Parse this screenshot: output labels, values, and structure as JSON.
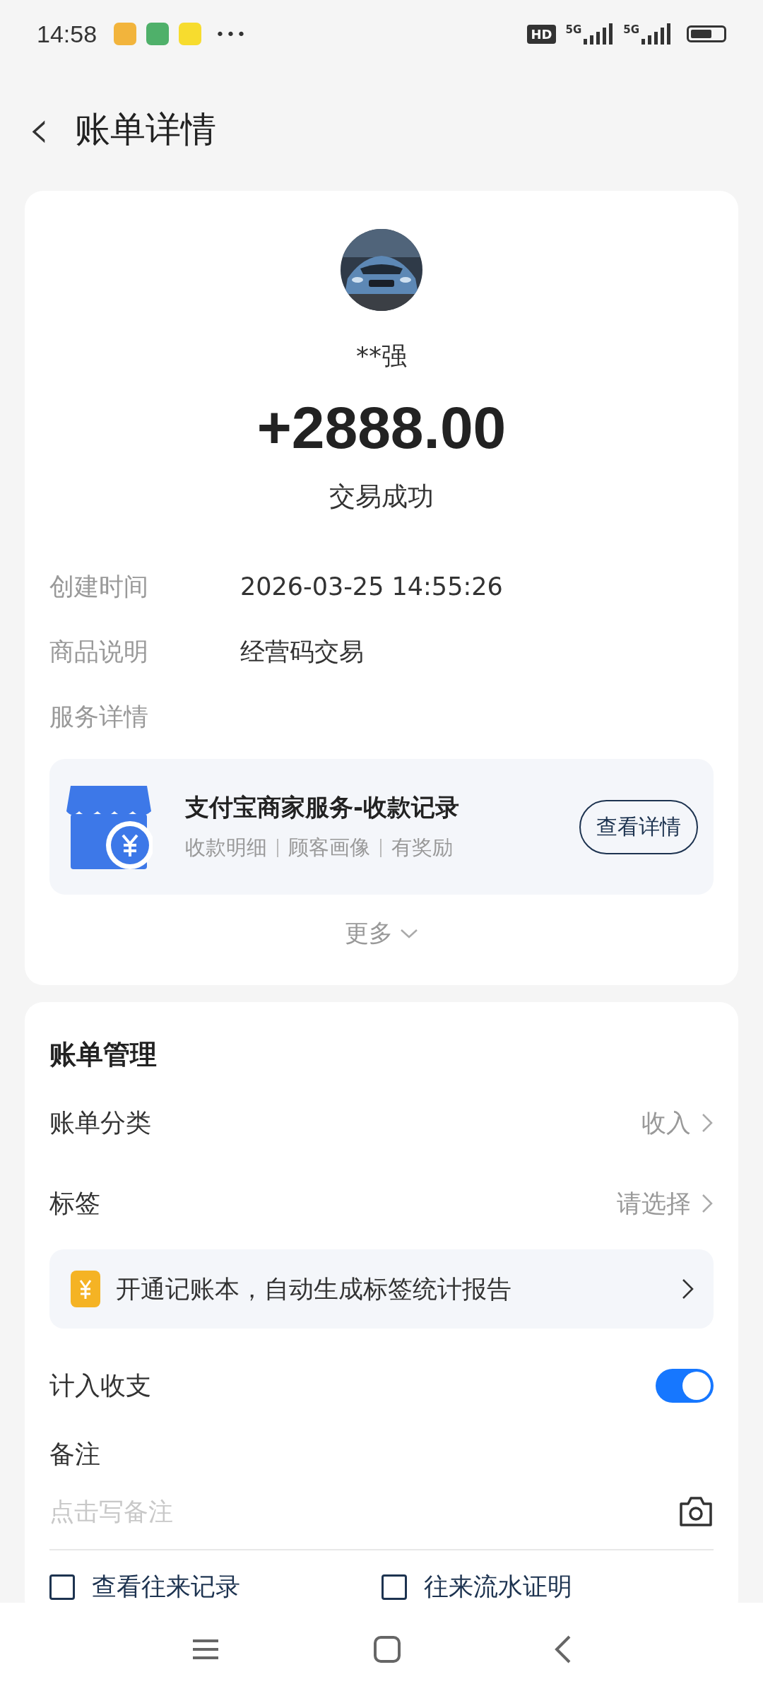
{
  "status_bar": {
    "time": "14:58",
    "notifications": [
      {
        "color": "#f2b43c"
      },
      {
        "color": "#4fb06a"
      },
      {
        "color": "#f7dc2e"
      }
    ],
    "more": "•••",
    "hd": "HD",
    "networks": [
      "5G",
      "5G"
    ]
  },
  "header": {
    "back": "‹",
    "title": "账单详情"
  },
  "summary": {
    "name": "**强",
    "amount": "+2888.00",
    "status": "交易成功"
  },
  "details": [
    {
      "label": "创建时间",
      "value": "2026-03-25 14:55:26"
    },
    {
      "label": "商品说明",
      "value": "经营码交易"
    },
    {
      "label": "服务详情"
    }
  ],
  "service": {
    "title": "支付宝商家服务-收款记录",
    "tags": [
      "收款明细",
      "顾客画像",
      "有奖励"
    ],
    "button": "查看详情"
  },
  "more": "更多",
  "management": {
    "title": "账单管理",
    "rows": [
      {
        "kind": "link",
        "label": "账单分类",
        "value": "收入"
      },
      {
        "kind": "link",
        "label": "标签",
        "value": "请选择"
      },
      {
        "kind": "promo",
        "text": "开通记账本，自动生成标签统计报告"
      },
      {
        "kind": "toggle",
        "label": "计入收支",
        "on": true
      }
    ],
    "note": {
      "label": "备注",
      "placeholder": "点击写备注"
    },
    "links": [
      "查看往来记录",
      "往来流水证明"
    ]
  }
}
